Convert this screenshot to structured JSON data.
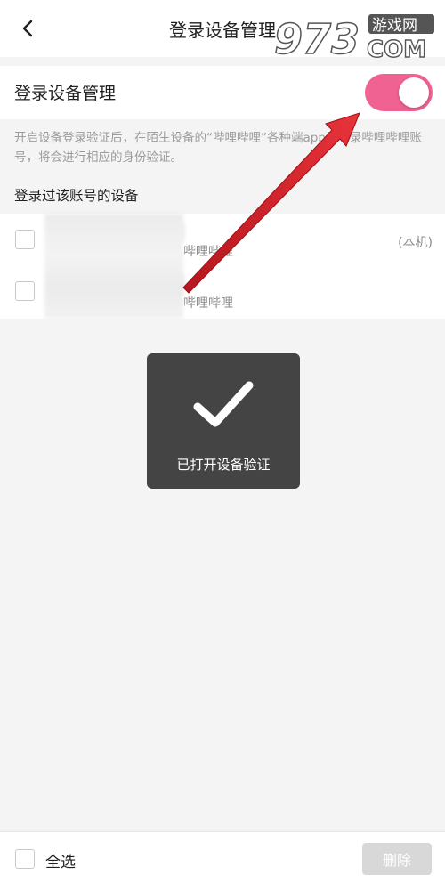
{
  "header": {
    "title": "登录设备管理",
    "back_icon": "chevron-left-icon"
  },
  "watermark": {
    "left_text": "973",
    "cn_text": "游戏网",
    "right_text": "COM"
  },
  "settings": {
    "toggle_label": "登录设备管理",
    "toggle_on": true,
    "description": "开启设备登录验证后，在陌生设备的“哔哩哔哩”各种端app里登录哔哩哔哩账号，将会进行相应的身份验证。",
    "section_title": "登录过该账号的设备"
  },
  "devices": [
    {
      "app": "哔哩哔哩",
      "current": "(本机)"
    },
    {
      "app": "哔哩哔哩",
      "current": ""
    }
  ],
  "toast": {
    "icon": "checkmark-icon",
    "message": "已打开设备验证"
  },
  "bottom": {
    "select_all_label": "全选",
    "delete_label": "删除"
  },
  "colors": {
    "accent_pink": "#f06292",
    "annotation_red": "#d9222a",
    "toast_bg": "#3c3c3c",
    "delete_disabled": "#d8d8d8"
  }
}
